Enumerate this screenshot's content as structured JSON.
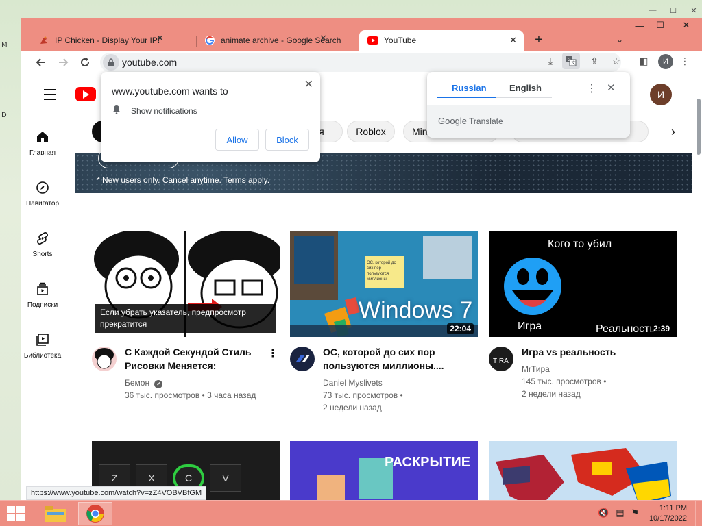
{
  "desktop": {
    "left_glyphs": [
      "M",
      "D"
    ]
  },
  "window": {
    "controls": [
      "—",
      "☐",
      "✕"
    ]
  },
  "tabs": [
    {
      "title": "IP Chicken - Display Your IP!",
      "favicon": "chicken-icon"
    },
    {
      "title": "animate archive - Google Search",
      "favicon": "google-g-icon"
    },
    {
      "title": "YouTube",
      "favicon": "youtube-icon"
    }
  ],
  "omnibox": {
    "url": "youtube.com"
  },
  "profile": {
    "initial": "И"
  },
  "notification_prompt": {
    "title": "www.youtube.com wants to",
    "permission": "Show notifications",
    "allow_label": "Allow",
    "block_label": "Block"
  },
  "translate_popup": {
    "lang_from": "Russian",
    "lang_to": "English",
    "brand_google": "Google",
    "brand_translate": "Translate"
  },
  "youtube": {
    "avatar_initial": "И",
    "chips": [
      "",
      "ия",
      "Roblox",
      "Min",
      ""
    ],
    "banner_text": "* New users only. Cancel anytime. Terms apply.",
    "sidebar": [
      {
        "label": "Главная",
        "icon": "home-icon"
      },
      {
        "label": "Навигатор",
        "icon": "compass-icon"
      },
      {
        "label": "Shorts",
        "icon": "shorts-icon"
      },
      {
        "label": "Подписки",
        "icon": "subscriptions-icon"
      },
      {
        "label": "Библиотека",
        "icon": "library-icon"
      }
    ],
    "videos": [
      {
        "title": "С Каждой Секундой Стиль Рисовки Меняется:",
        "channel": "Бемон",
        "verified": "✔",
        "views": "36 тыс. просмотров",
        "age": "3 часа назад",
        "hover_overlay": "Если убрать указатель, предпросмотр прекратится"
      },
      {
        "title": "ОС, которой до сих пор пользуются миллионы....",
        "channel": "Daniel Myslivets",
        "views": "73 тыс. просмотров",
        "age": "2 недели назад",
        "duration": "22:04",
        "thumb_text": "Windows 7",
        "note_text": "ОС, которой до сих пор пользуются миллионы"
      },
      {
        "title": "Игра vs реальность",
        "channel": "MrТира",
        "views": "145 тыс. просмотров",
        "age": "2 недели назад",
        "duration": "2:39",
        "thumb_top": "Кого то убил",
        "thumb_left": "Игра",
        "thumb_right": "Реальность"
      }
    ],
    "row2": [
      {
        "thumb_keys": [
          "Z",
          "X",
          "C",
          "V"
        ]
      },
      {
        "thumb_text": "РАСКРЫТИЕ"
      },
      {
        "thumb_text": ""
      }
    ]
  },
  "status_url": "https://www.youtube.com/watch?v=zZ4VOBVBfGM",
  "taskbar": {
    "time": "1:11 PM",
    "date": "10/17/2022"
  }
}
